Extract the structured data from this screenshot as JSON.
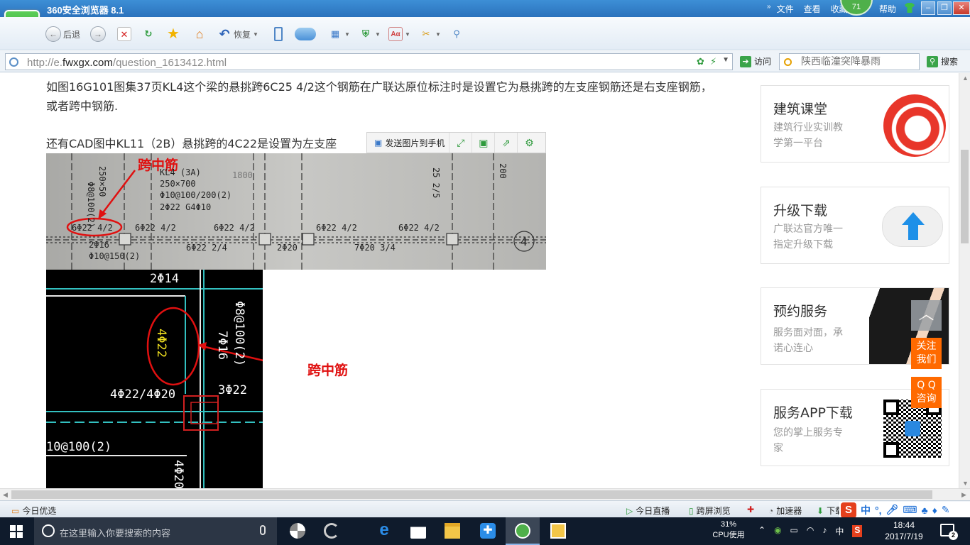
{
  "window": {
    "title": "360安全浏览器 8.1",
    "menu": [
      "文件",
      "查看",
      "收藏"
    ],
    "help": "帮助",
    "user_badge": "71"
  },
  "toolbar": {
    "back_label": "后退",
    "restore_label": "恢复"
  },
  "address": {
    "url_prefix": "http://e.",
    "url_domain": "fwxgx.com",
    "url_path": "/question_1613412.html",
    "visit_label": "访问",
    "search_placeholder": "陕西临潼突降暴雨",
    "search_label": "搜索"
  },
  "article": {
    "paragraph1": "如图16G101图集37页KL4这个梁的悬挑跨6C25 4/2这个钢筋在广联达原位标注时是设置它为悬挑跨的左支座钢筋还是右支座钢筋，或者跨中钢筋.",
    "paragraph2_start": "还有CAD图中KL11（2B）悬挑跨的4C22是设置为左支座",
    "paragraph2_end": "钢筋",
    "image_toolbar": {
      "send_label": "发送图片到手机"
    },
    "photo": {
      "annotation": "跨中筋",
      "labels": [
        "KL4 (3A)",
        "250×700",
        "Φ10@100/200(2)",
        "2Φ22 G4Φ10",
        "6Φ22 4/2",
        "6Φ22 4/2",
        "6Φ22 4/2",
        "6Φ22 4/2",
        "6Φ22 4/2",
        "6Φ22 2/4",
        "2Φ20",
        "7Φ20 3/4",
        "2Φ16",
        "Φ10@150(2)",
        "25 2/5",
        "200",
        "1800",
        "250×50",
        "Φ8@100(2)",
        "4"
      ]
    },
    "cad": {
      "annotation": "跨中筋",
      "labels": [
        "2Φ14",
        "4Φ22",
        "7Φ16",
        "Φ8@100(2)",
        "4Φ22/4Φ20",
        "3Φ22",
        "10@100(2)",
        "4Φ20"
      ]
    }
  },
  "sidebar": {
    "ads": [
      {
        "title": "建筑课堂",
        "subtitle": [
          "建筑行业实训教",
          "学第一平台"
        ]
      },
      {
        "title": "升级下载",
        "subtitle": [
          "广联达官方唯一",
          "指定升级下载"
        ]
      },
      {
        "title": "预约服务",
        "subtitle": [
          "服务面对面，承",
          "诺心连心"
        ]
      },
      {
        "title": "服务APP下载",
        "subtitle": [
          "您的掌上服务专",
          "家"
        ]
      }
    ],
    "float_buttons": [
      {
        "line1": "关注",
        "line2": "我们"
      },
      {
        "line1": "Q Q",
        "line2": "咨询"
      }
    ]
  },
  "statusbar": {
    "left": "今日优选",
    "items": [
      "今日直播",
      "跨屏浏览",
      "加速器",
      "下载"
    ],
    "ime": "中"
  },
  "taskbar": {
    "search_placeholder": "在这里输入你要搜索的内容",
    "cpu_percent": "31%",
    "cpu_label": "CPU使用",
    "ime": "中",
    "time": "18:44",
    "date": "2017/7/19",
    "notifications": "2"
  },
  "colors": {
    "title_bar": "#2b72bc",
    "annotation_red": "#e01010",
    "float_orange": "#ff6a00",
    "taskbar": "#0f1b2c"
  }
}
